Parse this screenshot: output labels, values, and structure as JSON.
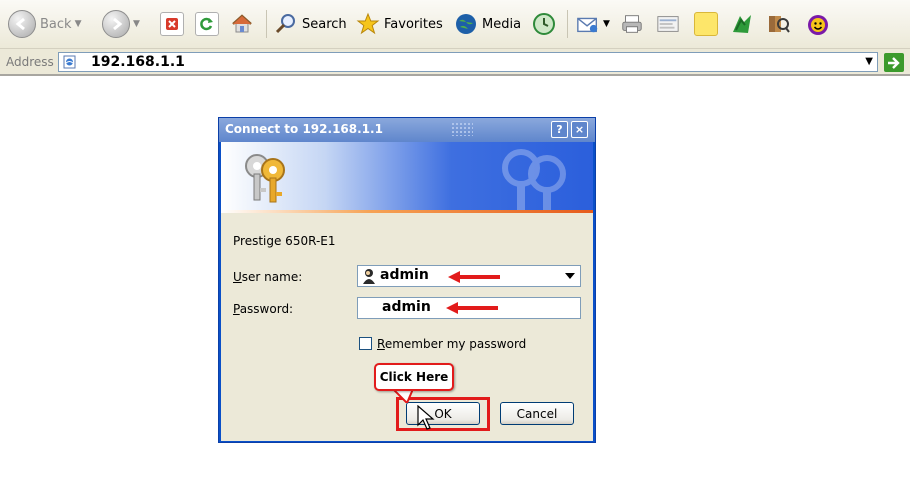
{
  "toolbar": {
    "back_label": "Back",
    "search_label": "Search",
    "favorites_label": "Favorites",
    "media_label": "Media"
  },
  "address": {
    "label": "Address",
    "url": "192.168.1.1"
  },
  "dialog": {
    "title": "Connect to 192.168.1.1",
    "realm": "Prestige 650R-E1",
    "username_label": "User name:",
    "password_label": "Password:",
    "username_value": "admin",
    "password_value": "admin",
    "remember_label": "Remember my password",
    "remember_checked": false,
    "ok_label": "OK",
    "cancel_label": "Cancel",
    "help_glyph": "?",
    "close_glyph": "×"
  },
  "annotation": {
    "callout_text": "Click Here"
  },
  "colors": {
    "annotation_red": "#e21b1b",
    "titlebar_blue": "#5f86cc",
    "dialog_bg": "#ece9d8"
  },
  "icons": [
    "back-icon",
    "forward-icon",
    "stop-icon",
    "refresh-icon",
    "home-icon",
    "search-icon",
    "favorites-icon",
    "media-icon",
    "history-icon",
    "mail-icon",
    "print-icon",
    "edit-icon",
    "note-icon",
    "messenger-icon",
    "research-icon",
    "yahoo-icon",
    "page-icon",
    "go-icon",
    "keys-icon",
    "user-icon",
    "cursor-icon"
  ]
}
